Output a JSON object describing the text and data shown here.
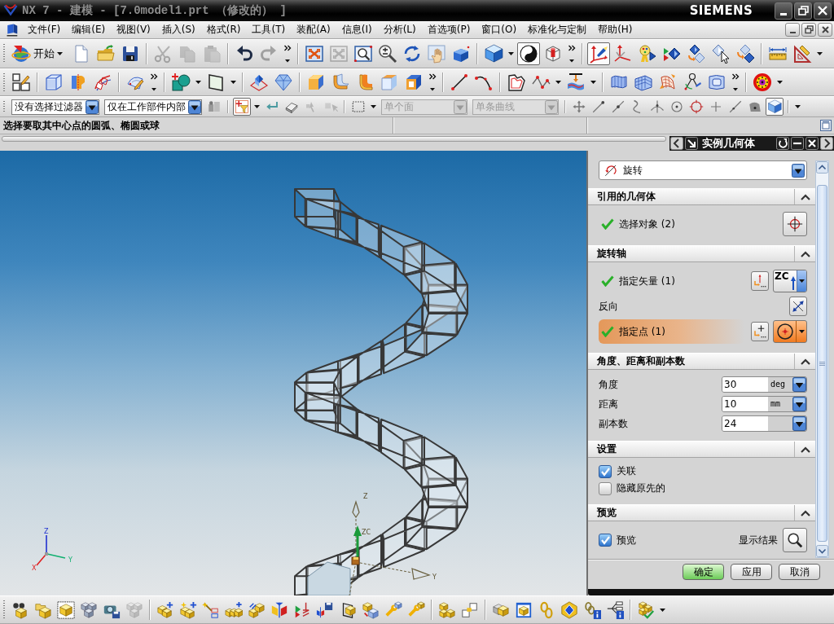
{
  "window": {
    "title": "NX 7 - 建模 - [7.0model1.prt （修改的） ]",
    "brand": "SIEMENS"
  },
  "menu_bar": {
    "items": [
      "文件(F)",
      "编辑(E)",
      "视图(V)",
      "插入(S)",
      "格式(R)",
      "工具(T)",
      "装配(A)",
      "信息(I)",
      "分析(L)",
      "首选项(P)",
      "窗口(O)",
      "标准化与定制",
      "帮助(H)"
    ]
  },
  "toolbars": [
    {
      "groups": [
        {
          "items": [
            {
              "kind": "start",
              "label": "开始",
              "disabled": false,
              "pressed": false
            },
            {
              "kind": "new",
              "disabled": false,
              "pressed": false
            },
            {
              "kind": "open",
              "disabled": false,
              "pressed": false
            },
            {
              "kind": "save",
              "disabled": false,
              "pressed": false
            }
          ]
        },
        {
          "items": [
            {
              "kind": "cut",
              "disabled": true,
              "pressed": false
            },
            {
              "kind": "copy",
              "disabled": true,
              "pressed": false
            },
            {
              "kind": "paste",
              "disabled": true,
              "pressed": false
            }
          ]
        },
        {
          "items": [
            {
              "kind": "undo",
              "disabled": false,
              "pressed": false
            },
            {
              "kind": "redo",
              "disabled": true,
              "pressed": false
            },
            {
              "kind": "more",
              "disabled": false,
              "pressed": false
            }
          ]
        },
        {
          "items": [
            {
              "kind": "fit",
              "disabled": false,
              "pressed": false
            },
            {
              "kind": "fit",
              "disabled": true,
              "pressed": false
            },
            {
              "kind": "zoomwin",
              "disabled": false,
              "pressed": false
            },
            {
              "kind": "zoom",
              "disabled": false,
              "pressed": false
            },
            {
              "kind": "rotate",
              "disabled": false,
              "pressed": false
            },
            {
              "kind": "pan",
              "disabled": false,
              "pressed": false
            },
            {
              "kind": "viewblock",
              "disabled": false,
              "pressed": false
            }
          ]
        },
        {
          "items": [
            {
              "kind": "cube",
              "disabled": false,
              "pressed": false
            },
            {
              "kind": "caret",
              "disabled": false,
              "pressed": false
            },
            {
              "kind": "render",
              "disabled": false,
              "pressed": true
            },
            {
              "kind": "cylbox",
              "disabled": false,
              "pressed": false
            },
            {
              "kind": "more",
              "disabled": false,
              "pressed": false
            }
          ]
        },
        {
          "items": [
            {
              "kind": "wcs",
              "disabled": false,
              "pressed": true
            },
            {
              "kind": "triad",
              "disabled": false,
              "pressed": false
            },
            {
              "kind": "palette",
              "disabled": false,
              "pressed": false
            },
            {
              "kind": "showhide",
              "disabled": false,
              "pressed": false
            },
            {
              "kind": "diamonds",
              "disabled": false,
              "pressed": false
            },
            {
              "kind": "diamondcursor",
              "disabled": false,
              "pressed": false
            },
            {
              "kind": "diamondsmove",
              "disabled": false,
              "pressed": false
            }
          ]
        },
        {
          "items": [
            {
              "kind": "ruler",
              "disabled": false,
              "pressed": false
            },
            {
              "kind": "setsquare",
              "disabled": false,
              "pressed": false
            },
            {
              "kind": "caret",
              "disabled": false,
              "pressed": false
            }
          ]
        }
      ]
    },
    {
      "groups": [
        {
          "items": [
            {
              "kind": "sketch",
              "disabled": false,
              "pressed": false
            }
          ]
        },
        {
          "items": [
            {
              "kind": "extrude",
              "disabled": false,
              "pressed": false
            },
            {
              "kind": "revolve",
              "disabled": false,
              "pressed": false
            },
            {
              "kind": "sweep",
              "disabled": false,
              "pressed": false
            }
          ]
        },
        {
          "items": [
            {
              "kind": "sketchedit",
              "disabled": false,
              "pressed": false
            },
            {
              "kind": "more",
              "disabled": false,
              "pressed": false
            }
          ]
        },
        {
          "items": [
            {
              "kind": "shapes",
              "disabled": false,
              "pressed": false
            },
            {
              "kind": "caret",
              "disabled": false,
              "pressed": false
            },
            {
              "kind": "plane",
              "disabled": false,
              "pressed": false
            },
            {
              "kind": "caret",
              "disabled": false,
              "pressed": false
            }
          ]
        },
        {
          "items": [
            {
              "kind": "pyramid",
              "disabled": false,
              "pressed": false
            },
            {
              "kind": "gem",
              "disabled": false,
              "pressed": false
            }
          ]
        },
        {
          "items": [
            {
              "kind": "boxorange",
              "disabled": false,
              "pressed": false
            },
            {
              "kind": "blend",
              "disabled": false,
              "pressed": false
            },
            {
              "kind": "blend2",
              "disabled": false,
              "pressed": false
            },
            {
              "kind": "boxtop",
              "disabled": false,
              "pressed": false
            },
            {
              "kind": "shell",
              "disabled": false,
              "pressed": false
            },
            {
              "kind": "more",
              "disabled": false,
              "pressed": false
            }
          ]
        },
        {
          "items": [
            {
              "kind": "line",
              "disabled": false,
              "pressed": false
            },
            {
              "kind": "arc",
              "disabled": false,
              "pressed": false
            }
          ]
        },
        {
          "items": [
            {
              "kind": "profile",
              "disabled": false,
              "pressed": false
            },
            {
              "kind": "polyline",
              "disabled": false,
              "pressed": false
            },
            {
              "kind": "caret",
              "disabled": false,
              "pressed": false
            },
            {
              "kind": "surfpush",
              "disabled": false,
              "pressed": false
            },
            {
              "kind": "caret",
              "disabled": false,
              "pressed": false
            }
          ]
        },
        {
          "items": [
            {
              "kind": "surface",
              "disabled": false,
              "pressed": false
            },
            {
              "kind": "mesh",
              "disabled": false,
              "pressed": false
            },
            {
              "kind": "meshwarp",
              "disabled": false,
              "pressed": false
            },
            {
              "kind": "compass",
              "disabled": false,
              "pressed": false
            },
            {
              "kind": "patch",
              "disabled": false,
              "pressed": false
            },
            {
              "kind": "more",
              "disabled": false,
              "pressed": false
            }
          ]
        },
        {
          "items": [
            {
              "kind": "ring",
              "disabled": false,
              "pressed": false
            },
            {
              "kind": "caret",
              "disabled": false,
              "pressed": false
            }
          ]
        }
      ]
    },
    {
      "groups": [
        {
          "items": [
            {
              "kind": "combo",
              "label": "没有选择过滤器",
              "disabled": false,
              "pressed": false
            },
            {
              "kind": "combo",
              "label": "仅在工作部件内部",
              "disabled": false,
              "pressed": false
            },
            {
              "kind": "parts",
              "disabled": false,
              "pressed": false
            }
          ]
        },
        {
          "items": [
            {
              "kind": "filter",
              "disabled": false,
              "pressed": true
            },
            {
              "kind": "caret",
              "disabled": false,
              "pressed": false
            },
            {
              "kind": "retarrow",
              "disabled": false,
              "pressed": false
            },
            {
              "kind": "eraser",
              "disabled": false,
              "pressed": false
            },
            {
              "kind": "select",
              "disabled": true,
              "pressed": false
            },
            {
              "kind": "select2",
              "disabled": true,
              "pressed": false
            }
          ]
        },
        {
          "items": [
            {
              "kind": "dashrect",
              "disabled": false,
              "pressed": false
            },
            {
              "kind": "caret",
              "disabled": false,
              "pressed": false
            },
            {
              "kind": "combo",
              "label": "单个面",
              "disabled": true,
              "pressed": false
            },
            {
              "kind": "combo",
              "label": "单条曲线",
              "disabled": true,
              "pressed": false
            }
          ]
        },
        {
          "items": [
            {
              "kind": "move",
              "disabled": false,
              "pressed": false
            },
            {
              "kind": "endpoint",
              "disabled": false,
              "pressed": false
            },
            {
              "kind": "midpoint",
              "disabled": false,
              "pressed": false
            },
            {
              "kind": "curve",
              "disabled": false,
              "pressed": false
            },
            {
              "kind": "intersect",
              "disabled": false,
              "pressed": false
            },
            {
              "kind": "center",
              "disabled": false,
              "pressed": false
            },
            {
              "kind": "quadrant",
              "disabled": false,
              "pressed": false
            },
            {
              "kind": "plus",
              "disabled": false,
              "pressed": false
            },
            {
              "kind": "online",
              "disabled": false,
              "pressed": false
            },
            {
              "kind": "facepoint",
              "disabled": false,
              "pressed": false
            },
            {
              "kind": "viewcube",
              "disabled": false,
              "pressed": true
            }
          ]
        },
        {
          "items": [
            {
              "kind": "caret",
              "disabled": false,
              "pressed": false
            }
          ]
        }
      ]
    }
  ],
  "cue_line": {
    "text": "选择要取其中心点的圆弧、椭圆或球"
  },
  "dialog": {
    "title": "实例几何体",
    "type": "旋转",
    "sections": [
      {
        "title": "引用的几何体",
        "expanded": true,
        "rows": [
          {
            "kind": "object",
            "label": "选择对象 (2)",
            "done": true,
            "active": false
          }
        ]
      },
      {
        "title": "旋转轴",
        "expanded": true,
        "rows": [
          {
            "kind": "vector",
            "label": "指定矢量 (1)",
            "done": true,
            "active": false,
            "option": "ZC"
          },
          {
            "kind": "flip",
            "label": "反向"
          },
          {
            "kind": "point",
            "label": "指定点 (1)",
            "done": true,
            "active": true
          }
        ]
      },
      {
        "title": "角度、距离和副本数",
        "expanded": true,
        "rows": [
          {
            "kind": "number",
            "label": "角度",
            "value": "30",
            "unit": "deg"
          },
          {
            "kind": "number",
            "label": "距离",
            "value": "10",
            "unit": "mm"
          },
          {
            "kind": "number",
            "label": "副本数",
            "value": "24"
          }
        ]
      },
      {
        "title": "设置",
        "expanded": true,
        "rows": [
          {
            "kind": "checkbox",
            "label": "关联",
            "checked": true
          },
          {
            "kind": "checkbox",
            "label": "隐藏原先的",
            "checked": false
          }
        ]
      },
      {
        "title": "预览",
        "expanded": true,
        "rows": [
          {
            "kind": "checkbox",
            "label": "预览",
            "checked": true,
            "action": "显示结果"
          }
        ]
      }
    ],
    "buttons": [
      {
        "label": "确定",
        "default": true
      },
      {
        "label": "应用",
        "default": false
      },
      {
        "label": "取消",
        "default": false
      }
    ]
  },
  "viewport": {
    "wcs_labels": [
      "Z",
      "ZC",
      "Y"
    ],
    "triad_labels": [
      "Z",
      "Y",
      "X"
    ]
  },
  "bottom_toolbar": {
    "groups": [
      {
        "items": [
          {
            "kind": "bincube",
            "disabled": false,
            "pressed": false
          },
          {
            "kind": "foldercube",
            "disabled": false,
            "pressed": false
          },
          {
            "kind": "framecube",
            "disabled": false,
            "pressed": false
          },
          {
            "kind": "cubegrid",
            "disabled": false,
            "pressed": false
          },
          {
            "kind": "camera",
            "disabled": false,
            "pressed": false
          },
          {
            "kind": "cubegrid",
            "disabled": true,
            "pressed": false
          }
        ]
      },
      {
        "items": [
          {
            "kind": "cubesplus",
            "disabled": false,
            "pressed": false
          },
          {
            "kind": "cubesstar",
            "disabled": false,
            "pressed": false
          },
          {
            "kind": "wand",
            "disabled": false,
            "pressed": false
          },
          {
            "kind": "rowplus",
            "disabled": false,
            "pressed": false
          },
          {
            "kind": "cubesarrow",
            "disabled": false,
            "pressed": false
          },
          {
            "kind": "mirror",
            "disabled": false,
            "pressed": false
          },
          {
            "kind": "constraint",
            "disabled": false,
            "pressed": false
          },
          {
            "kind": "mirrordisk",
            "disabled": false,
            "pressed": false
          },
          {
            "kind": "cubeplane",
            "disabled": false,
            "pressed": false
          },
          {
            "kind": "cubesmove",
            "disabled": false,
            "pressed": false
          },
          {
            "kind": "wrench",
            "disabled": false,
            "pressed": false
          },
          {
            "kind": "wrench2",
            "disabled": false,
            "pressed": false
          }
        ]
      },
      {
        "items": [
          {
            "kind": "cubespair",
            "disabled": false,
            "pressed": false
          },
          {
            "kind": "squares",
            "disabled": false,
            "pressed": false
          }
        ]
      },
      {
        "items": [
          {
            "kind": "cubeshadow",
            "disabled": false,
            "pressed": false
          },
          {
            "kind": "cubewindow",
            "disabled": false,
            "pressed": false
          },
          {
            "kind": "chain",
            "disabled": false,
            "pressed": false
          },
          {
            "kind": "diamondtile",
            "disabled": false,
            "pressed": false
          },
          {
            "kind": "chaininfo",
            "disabled": false,
            "pressed": false
          },
          {
            "kind": "treeinfo",
            "disabled": false,
            "pressed": false
          }
        ]
      },
      {
        "items": [
          {
            "kind": "cubescheck",
            "disabled": false,
            "pressed": false
          },
          {
            "kind": "caret",
            "disabled": false,
            "pressed": false
          }
        ]
      }
    ]
  }
}
